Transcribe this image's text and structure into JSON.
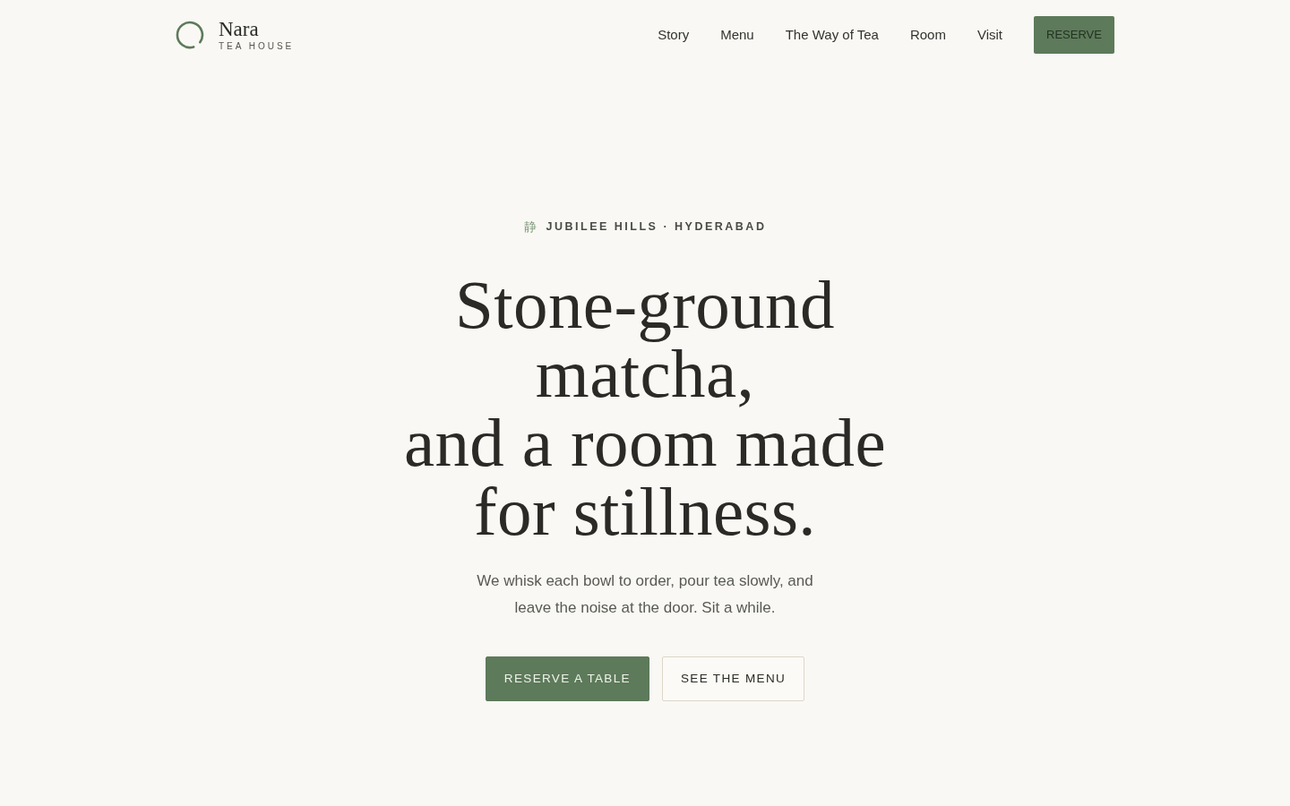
{
  "brand": {
    "name": "Nara",
    "tagline": "TEA HOUSE"
  },
  "nav": {
    "links": [
      "Story",
      "Menu",
      "The Way of Tea",
      "Room",
      "Visit"
    ],
    "cta": "RESERVE"
  },
  "hero": {
    "eyebrow_glyph": "静",
    "eyebrow": "JUBILEE HILLS · HYDERABAD",
    "heading_lines": [
      "Stone-ground",
      "matcha,",
      "and a room made",
      "for stillness."
    ],
    "lead": "We whisk each bowl to order, pour tea slowly, and leave the noise at the door. Sit a while.",
    "buttons": [
      {
        "label": "RESERVE A TABLE",
        "kind": "primary"
      },
      {
        "label": "SEE THE MENU",
        "kind": "secondary"
      }
    ]
  }
}
